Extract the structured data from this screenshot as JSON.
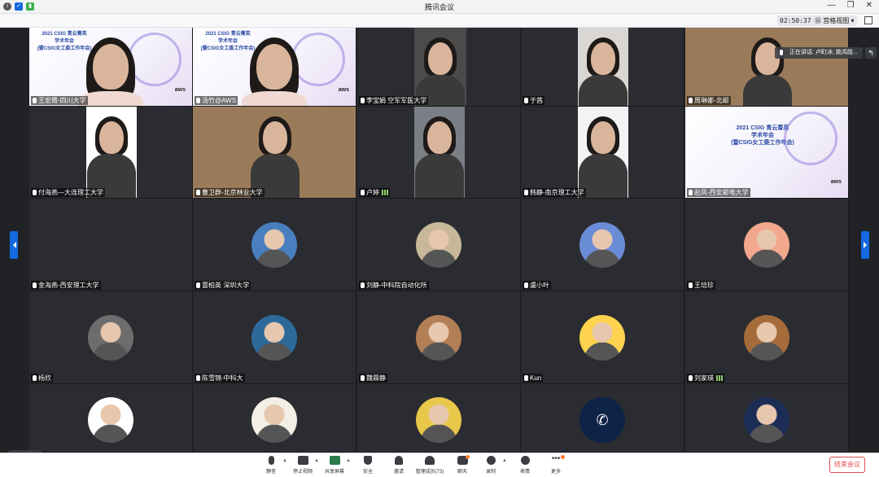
{
  "window": {
    "title": "腾讯会议"
  },
  "toolbar": {
    "timer": "02:50:37",
    "view_label": "宫格视图"
  },
  "speaker": {
    "text": "正在讲话: 卢町冰; 姚鸿勋..."
  },
  "colors": {
    "accent": "#1468e0",
    "end": "#e34d4d",
    "bg": "#202226"
  },
  "participants": [
    {
      "name": "王宏霞-四川大学",
      "kind": "slide-video",
      "signal": false
    },
    {
      "name": "汤竹@AWS",
      "kind": "slide-video",
      "signal": false
    },
    {
      "name": "李宝娟 空军军医大学",
      "kind": "video",
      "signal": false
    },
    {
      "name": "于茜",
      "kind": "video",
      "signal": false
    },
    {
      "name": "周琳娜-北邮",
      "kind": "video",
      "signal": false
    },
    {
      "name": "付海燕—大连理工大学",
      "kind": "video",
      "signal": false
    },
    {
      "name": "曹卫群-北京林业大学",
      "kind": "video",
      "signal": false
    },
    {
      "name": "卢婷",
      "kind": "video",
      "signal": true
    },
    {
      "name": "韩静-南京理工大学",
      "kind": "video",
      "signal": false
    },
    {
      "name": "赵凤-西安邮电大学",
      "kind": "slide",
      "signal": false
    },
    {
      "name": "金海燕-西安理工大学",
      "kind": "empty",
      "signal": false
    },
    {
      "name": "雷柏英 深圳大学",
      "kind": "avatar",
      "signal": false
    },
    {
      "name": "刘静-中科院自动化所",
      "kind": "avatar",
      "signal": false
    },
    {
      "name": "虞小叶",
      "kind": "avatar",
      "signal": false
    },
    {
      "name": "王培珍",
      "kind": "avatar",
      "signal": false
    },
    {
      "name": "杨欣",
      "kind": "avatar",
      "signal": false
    },
    {
      "name": "陈雪锦-中科大",
      "kind": "avatar",
      "signal": false
    },
    {
      "name": "魏霖静",
      "kind": "avatar",
      "signal": false
    },
    {
      "name": "Kun",
      "kind": "avatar",
      "signal": false
    },
    {
      "name": "刘家瑛",
      "kind": "avatar",
      "signal": true
    },
    {
      "name": "",
      "kind": "avatar",
      "signal": false
    },
    {
      "name": "",
      "kind": "avatar",
      "signal": false
    },
    {
      "name": "",
      "kind": "avatar",
      "signal": false
    },
    {
      "name": "",
      "kind": "avatar",
      "signal": false
    },
    {
      "name": "",
      "kind": "avatar",
      "signal": false
    }
  ],
  "slide": {
    "line1": "2021 CSIG 青云菁英",
    "line2": "学术年会",
    "line3": "(暨CSIG女工委工作年会)",
    "logo": "aws"
  },
  "bottom_bar": {
    "mute": "静音",
    "video": "停止视频",
    "share": "共享屏幕",
    "security": "安全",
    "invite": "邀请",
    "members": "管理成员(73)",
    "chat": "聊天",
    "record": "录制",
    "reactions": "表情",
    "more": "更多",
    "end": "结束会议"
  }
}
